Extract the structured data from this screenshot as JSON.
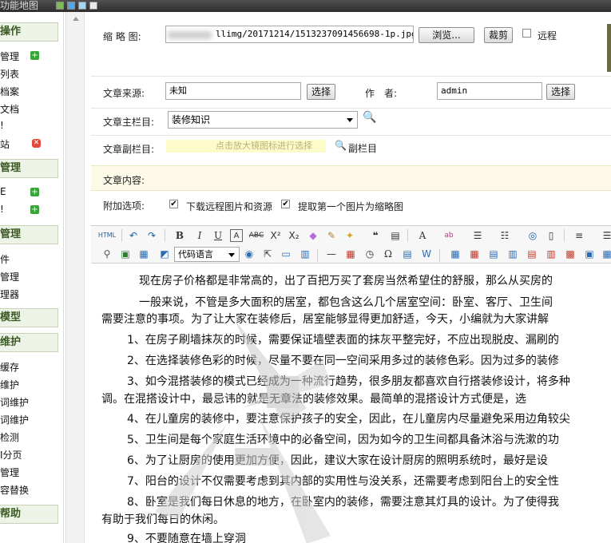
{
  "topbar": {
    "title": "功能地图"
  },
  "sidebar": {
    "sections": [
      {
        "label": "操作",
        "items": [
          {
            "label": "管理",
            "icon": "plus-icon"
          },
          {
            "label": "列表"
          },
          {
            "label": "档案"
          },
          {
            "label": "文档"
          },
          {
            "label": "!"
          },
          {
            "label": "站",
            "icon": "stop-icon"
          }
        ]
      },
      {
        "label": "管理",
        "items": [
          {
            "label": "E",
            "icon": "plus-icon"
          },
          {
            "label": "!",
            "icon": "plus-icon"
          }
        ]
      },
      {
        "label": "管理",
        "items": [
          {
            "label": "件"
          },
          {
            "label": "管理"
          },
          {
            "label": "理器"
          }
        ]
      },
      {
        "label": "模型",
        "items": []
      },
      {
        "label": "维护",
        "items": [
          {
            "label": "缓存"
          },
          {
            "label": "维护"
          },
          {
            "label": "词维护"
          },
          {
            "label": "词维护"
          },
          {
            "label": "检测"
          },
          {
            "label": "I分页"
          },
          {
            "label": "管理"
          },
          {
            "label": "容替换"
          }
        ]
      },
      {
        "label": "帮助",
        "items": []
      }
    ]
  },
  "form": {
    "thumb_label": "缩 略 图:",
    "thumb_path": "llimg/20171214/1513237091456698-1p.jpg",
    "browse_label": "浏览...",
    "crop_label": "裁剪",
    "remote_label": "远程",
    "source_label": "文章来源:",
    "source_value": "未知",
    "select_label": "选择",
    "author_label": "作　者:",
    "author_value": "admin",
    "main_col_label": "文章主栏目:",
    "main_col_value": "装修知识",
    "sub_col_label": "文章副栏目:",
    "sub_col_hint": "点击放大镜图标进行选择",
    "sub_col_link": "副栏目",
    "content_label": "文章内容:",
    "extra_label": "附加选项:",
    "opt1": "下载远程图片和资源",
    "opt2": "提取第一个图片为缩略图"
  },
  "toolbar": {
    "html_label": "HTML",
    "code_lang": "代码语言"
  },
  "editor": {
    "paragraphs": [
      "现在房子价格都是非常高的，出了百把万买了套房当然希望住的舒服，那么从买房的",
      "一般来说，不管是多大面积的居室，都包含这么几个居室空间：卧室、客厅、卫生间",
      "需要注意的事项。为了让大家在装修后，居室能够显得更加舒适，今天，小编就为大家讲解",
      "1、在房子刷墙抹灰的时候，需要保证墙壁表面的抹灰平整完好，不应出现脱皮、漏刷的",
      "2、在选择装修色彩的时候，尽量不要在同一空间采用多过的装修色彩。因为过多的装修",
      "3、如今混搭装修的模式已经成为一种流行趋势，很多朋友都喜欢自行搭装修设计，将多种",
      "调。在混搭设计中，最忌讳的就是无章法的装修效果。最简单的混搭设计方式便是，选",
      "4、在儿童房的装修中，要注意保护孩子的安全，因此，在儿童房内尽量避免采用边角较尖",
      "5、卫生间是每个家庭生活环境中的必备空间，因为如今的卫生间都具备沐浴与洗漱的功",
      "6、为了让厨房的使用更加方便，因此，建议大家在设计厨房的照明系统时，最好是设",
      "7、阳台的设计不仅需要考虑到其内部的实用性与没关系，还需要考虑到阳台上的安全性",
      "8、卧室是我们每日休息的地方，在卧室内的装修，需要注意其灯具的设计。为了使得我",
      "有助于我们每日的休闲。",
      "9、不要随意在墙上穿洞"
    ]
  },
  "colors": {
    "accent": "#3b5a23",
    "section_bg": "#eef3e7",
    "topbar": "#3a3a3a"
  }
}
